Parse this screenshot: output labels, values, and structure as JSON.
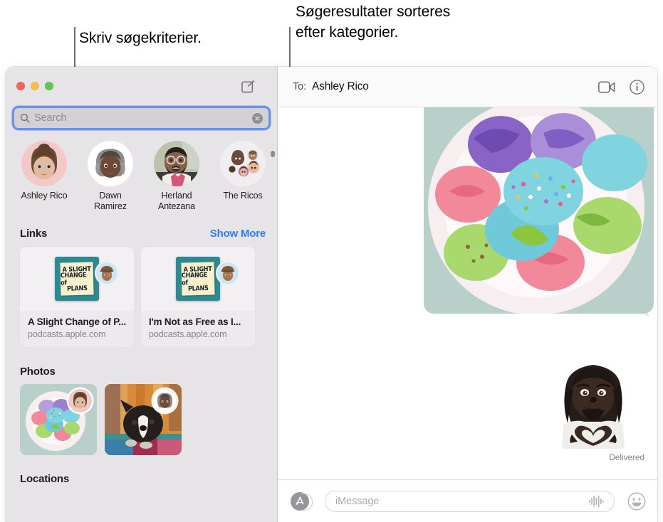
{
  "annotations": {
    "left": "Skriv søgekriterier.",
    "right_line1": "Søgeresultater sorteres",
    "right_line2": "efter kategorier."
  },
  "window": {
    "traffic_lights": {
      "close_label": "close",
      "minimize_label": "minimize",
      "zoom_label": "zoom"
    }
  },
  "sidebar": {
    "compose_icon": "compose-icon",
    "search": {
      "placeholder": "Search",
      "value": "",
      "icon": "search-icon",
      "clear_icon": "clear-icon"
    },
    "contacts": [
      {
        "name": "Ashley Rico",
        "avatar": "memoji-ashley"
      },
      {
        "name": "Dawn Ramirez",
        "avatar": "memoji-dawn"
      },
      {
        "name": "Herland Antezana",
        "avatar": "photo-herland"
      },
      {
        "name": "The Ricos",
        "avatar": "group-the-ricos"
      }
    ],
    "links": {
      "title": "Links",
      "action": "Show More",
      "cards": [
        {
          "title": "A Slight Change of P...",
          "domain": "podcasts.apple.com",
          "cover_lines": [
            "A  SLIGHT",
            "CHANGE of",
            "PLANS"
          ]
        },
        {
          "title": "I'm Not as Free as I...",
          "domain": "podcasts.apple.com",
          "cover_lines": [
            "A  SLIGHT",
            "CHANGE of",
            "PLANS"
          ]
        }
      ]
    },
    "photos": {
      "title": "Photos",
      "items": [
        {
          "alt": "plate-of-macarons",
          "sender_avatar": "memoji-ashley"
        },
        {
          "alt": "french-bulldog-on-rug",
          "sender_avatar": "memoji-dawn"
        }
      ]
    },
    "locations": {
      "title": "Locations"
    }
  },
  "conversation": {
    "to_label": "To:",
    "recipient": "Ashley Rico",
    "facetime_icon": "video-camera-icon",
    "details_icon": "info-icon",
    "messages": [
      {
        "type": "photo",
        "alt": "plate-of-pastel-macarons"
      },
      {
        "type": "sticker",
        "alt": "memoji-heart-hands",
        "status": "Delivered"
      }
    ],
    "status": "Delivered",
    "compose": {
      "apps_icon": "app-store-icon",
      "placeholder": "iMessage",
      "value": "",
      "audio_icon": "audio-waveform-icon",
      "emoji_icon": "smiley-icon"
    }
  },
  "colors": {
    "accent_blue": "#2f7cf6",
    "focus_ring": "#5686f2",
    "sidebar_bg": "#e6e4e7",
    "header_bg": "#fbfafb",
    "muted_text": "#86868b"
  }
}
